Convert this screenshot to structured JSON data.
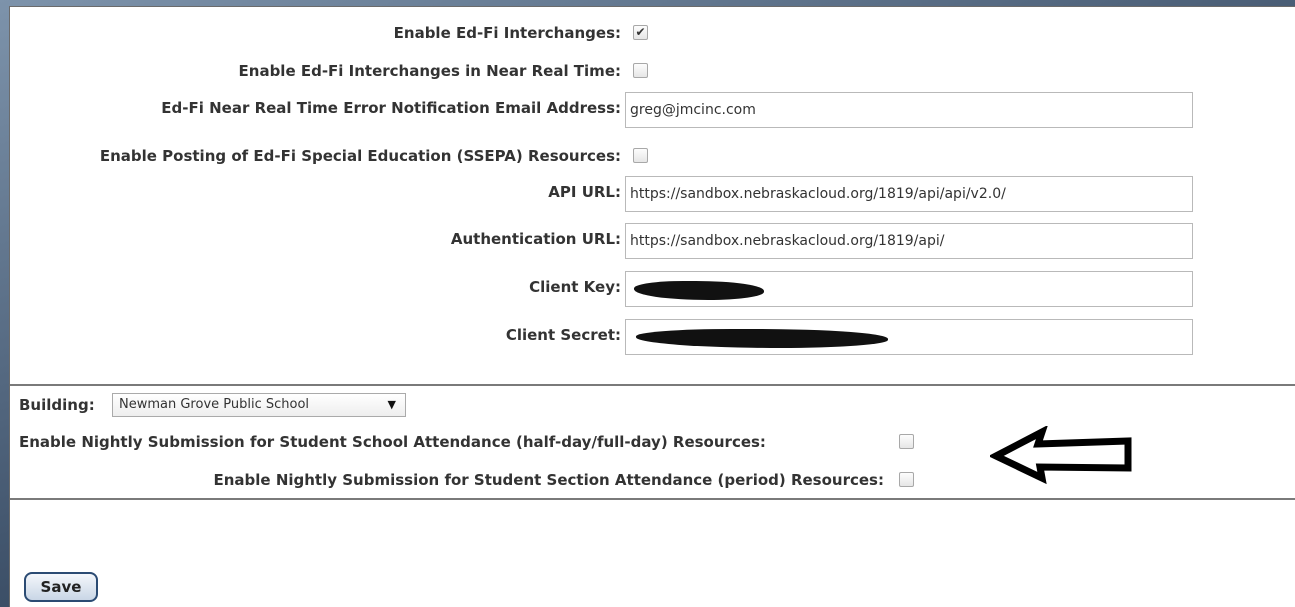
{
  "form": {
    "rows": [
      {
        "label": "Enable Ed-Fi Interchanges:",
        "type": "checkbox",
        "checked": true
      },
      {
        "label": "Enable Ed-Fi Interchanges in Near Real Time:",
        "type": "checkbox",
        "checked": false
      },
      {
        "label": "Ed-Fi Near Real Time Error Notification Email Address:",
        "type": "text",
        "value": "greg@jmcinc.com"
      },
      {
        "label": "Enable Posting of Ed-Fi Special Education (SSEPA) Resources:",
        "type": "checkbox",
        "checked": false
      },
      {
        "label": "API URL:",
        "type": "text",
        "value": "https://sandbox.nebraskacloud.org/1819/api/api/v2.0/"
      },
      {
        "label": "Authentication URL:",
        "type": "text",
        "value": "https://sandbox.nebraskacloud.org/1819/api/"
      },
      {
        "label": "Client Key:",
        "type": "redacted"
      },
      {
        "label": "Client Secret:",
        "type": "redacted"
      }
    ],
    "checkmark": "✔"
  },
  "building": {
    "label": "Building:",
    "selected": "Newman Grove Public School",
    "arrow": "▼",
    "attendance_half_full_label": "Enable Nightly Submission for Student School Attendance (half-day/full-day) Resources:",
    "attendance_period_label": "Enable Nightly Submission for Student Section Attendance (period) Resources:"
  },
  "actions": {
    "save_label": "Save"
  },
  "colors": {
    "save_border": "#2b4b73",
    "label_text": "#333333"
  }
}
